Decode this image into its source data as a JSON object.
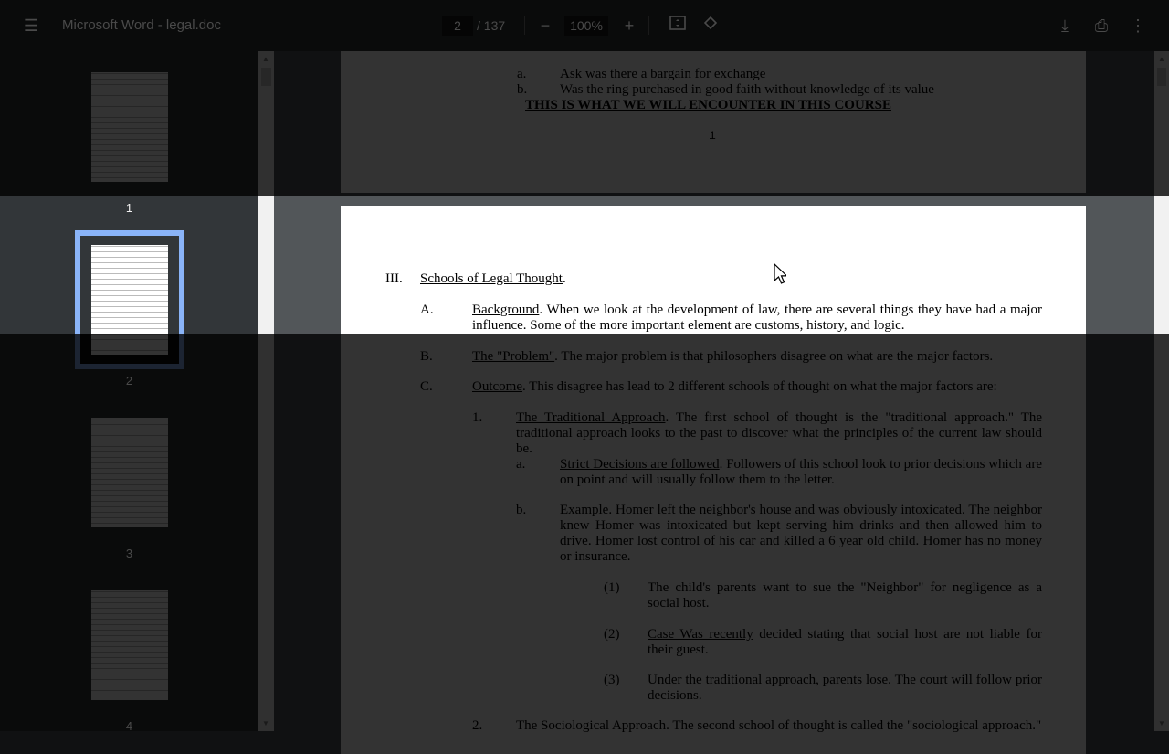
{
  "toolbar": {
    "menu_icon": "hamburger-menu-icon",
    "title": "Microsoft Word - legal.doc",
    "current_page": "2",
    "total_pages": "/ 137",
    "zoom": "100%",
    "zoom_out_icon": "minus-icon",
    "zoom_in_icon": "plus-icon",
    "fit_icon": "fit-to-page-icon",
    "rotate_icon": "rotate-icon",
    "download_icon": "download-icon",
    "print_icon": "print-icon",
    "more_icon": "more-vert-icon"
  },
  "thumbnails": [
    {
      "label": "1"
    },
    {
      "label": "2",
      "selected": true
    },
    {
      "label": "3"
    },
    {
      "label": "4"
    }
  ],
  "page1": {
    "items": [
      {
        "label": "a.",
        "text": "Ask was there a bargain for exchange"
      },
      {
        "label": "b.",
        "text": "Was the ring purchased in good faith without knowledge of its value"
      }
    ],
    "heading": "THIS IS WHAT WE WILL ENCOUNTER IN THIS COURSE",
    "page_number": "1"
  },
  "page2": {
    "iii": {
      "label": "III.",
      "title": "Schools of Legal Thought",
      "rest": "."
    },
    "a": {
      "label": "A.",
      "title": "Background",
      "rest": ".  When we look at the development of law, there are several things they have had a major influence.  Some of the more important element are customs, history, and logic."
    },
    "b": {
      "label": "B.",
      "title": "The \"Problem\"",
      "rest": ".  The major problem is that philosophers disagree on what are the major factors."
    },
    "c": {
      "label": "C.",
      "title": "Outcome",
      "rest": ".  This disagree has lead to 2 different schools of thought on what the major factors are:"
    },
    "c1": {
      "label": "1.",
      "title": "The Traditional Approach",
      "rest": ".  The first school of thought is the \"traditional approach.\"  The traditional approach looks to the past to discover what the principles of the current law should be."
    },
    "c1a": {
      "label": "a.",
      "title": "Strict Decisions are followed",
      "rest": ".  Followers of this school look to prior decisions which are on point and will usually follow them to the letter."
    },
    "c1b": {
      "label": "b.",
      "title": "Example",
      "rest": ".  Homer left the neighbor's house and was obviously intoxicated.  The neighbor knew Homer was intoxicated but kept serving him drinks and then allowed him to drive.  Homer lost control of his car and killed a 6 year old child.  Homer has no money or insurance."
    },
    "p1": {
      "label": "(1)",
      "text": "The child's parents want to sue the \"Neighbor\" for negligence as a social host."
    },
    "p2": {
      "label": "(2)",
      "title": "Case Was recently",
      "rest": " decided stating that social host are not liable for their guest."
    },
    "p3": {
      "label": "(3)",
      "text": "Under the traditional approach, parents lose.  The court will follow prior decisions."
    },
    "c2": {
      "label": "2.",
      "text": "The Sociological Approach.  The second school of thought is called the \"sociological approach.\""
    }
  },
  "colors": {
    "toolbar": "#323639",
    "sidebar": "#323639",
    "viewer_bg": "#525659",
    "thumbnail_selected": "#8ab4f8"
  }
}
